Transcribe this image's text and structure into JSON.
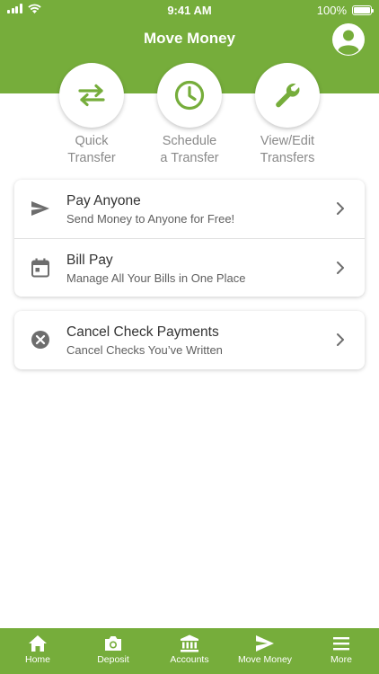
{
  "status_bar": {
    "time": "9:41 AM",
    "battery": "100%"
  },
  "header": {
    "title": "Move Money"
  },
  "quick_actions": [
    {
      "label": "Quick\nTransfer",
      "icon": "swap-arrows-icon"
    },
    {
      "label": "Schedule\na Transfer",
      "icon": "clock-icon"
    },
    {
      "label": "View/Edit\nTransfers",
      "icon": "wrench-icon"
    }
  ],
  "cards": [
    {
      "items": [
        {
          "title": "Pay Anyone",
          "subtitle": "Send Money to Anyone for Free!",
          "icon": "send-icon"
        },
        {
          "title": "Bill Pay",
          "subtitle": "Manage All Your Bills in One Place",
          "icon": "calendar-icon"
        }
      ]
    },
    {
      "items": [
        {
          "title": "Cancel Check Payments",
          "subtitle": "Cancel Checks You’ve Written",
          "icon": "cancel-circle-icon"
        }
      ]
    }
  ],
  "tabbar": {
    "active": "Move Money",
    "tabs": [
      {
        "label": "Home",
        "icon": "home-icon"
      },
      {
        "label": "Deposit",
        "icon": "camera-icon"
      },
      {
        "label": "Accounts",
        "icon": "bank-icon"
      },
      {
        "label": "Move Money",
        "icon": "send-icon"
      },
      {
        "label": "More",
        "icon": "menu-icon"
      }
    ]
  },
  "colors": {
    "brand_green": "#76ad3b",
    "icon_gray": "#6d6d6d",
    "text_gray": "#8a8a8a"
  }
}
